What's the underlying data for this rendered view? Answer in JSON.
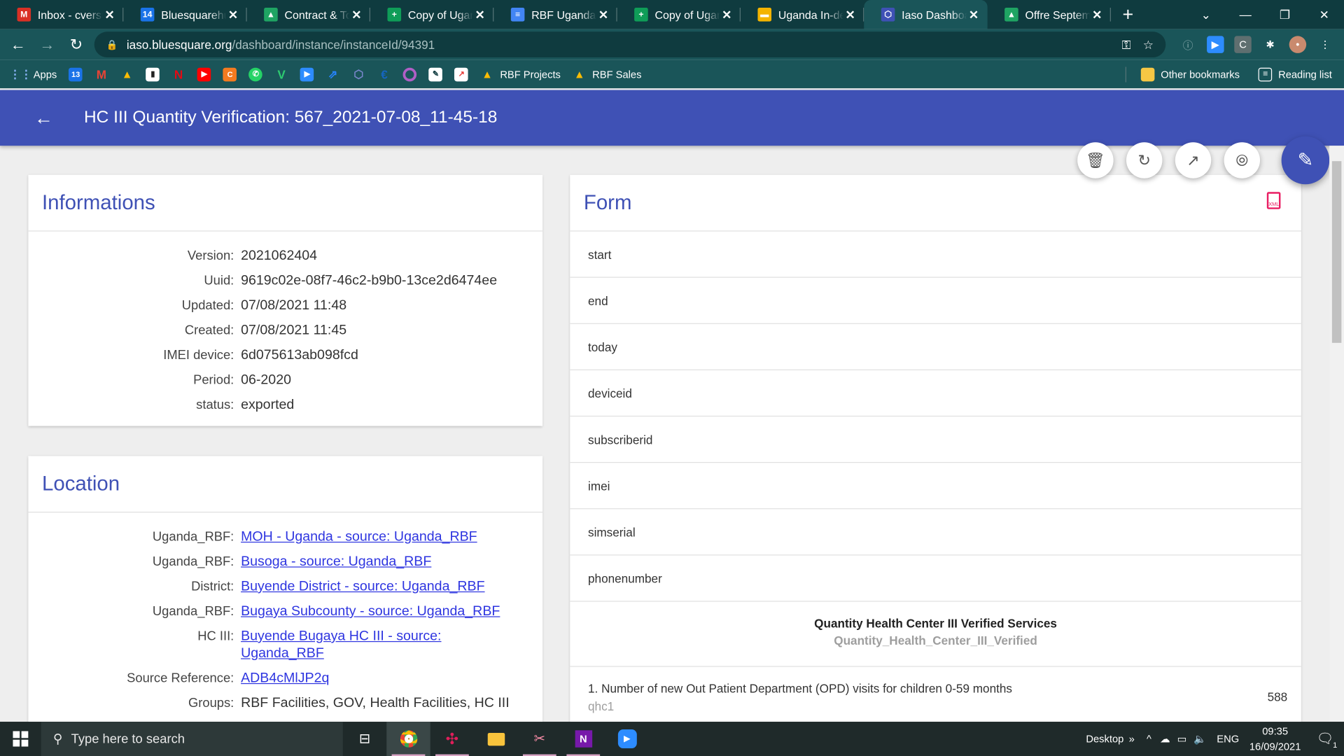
{
  "browser": {
    "tabs": [
      {
        "title": "Inbox - cverstr",
        "fav": "M",
        "color": "#d93025"
      },
      {
        "title": "Bluesquarehub",
        "fav": "14",
        "color": "#1a73e8"
      },
      {
        "title": "Contract & Tol",
        "fav": "▲",
        "color": "#1fa463"
      },
      {
        "title": "Copy of Uganda",
        "fav": "+",
        "color": "#0f9d58"
      },
      {
        "title": "RBF Uganda -",
        "fav": "≡",
        "color": "#4285f4"
      },
      {
        "title": "Copy of Uganda",
        "fav": "+",
        "color": "#0f9d58"
      },
      {
        "title": "Uganda In-dep",
        "fav": "▬",
        "color": "#f4b400"
      },
      {
        "title": "Iaso Dashboard",
        "fav": "⬡",
        "color": "#3f51b5"
      },
      {
        "title": "Offre Septemb",
        "fav": "▲",
        "color": "#1fa463"
      }
    ],
    "url_host": "iaso.bluesquare.org",
    "url_path": "/dashboard/instance/instanceId/94391",
    "bookmarks": {
      "apps": "Apps",
      "rbf_projects": "RBF Projects",
      "rbf_sales": "RBF Sales",
      "other": "Other bookmarks",
      "reading": "Reading list"
    }
  },
  "header": {
    "title": "HC III Quantity Verification: 567_2021-07-08_11-45-18"
  },
  "informations": {
    "title": "Informations",
    "rows": [
      {
        "label": "Version:",
        "value": "2021062404"
      },
      {
        "label": "Uuid:",
        "value": "9619c02e-08f7-46c2-b9b0-13ce2d6474ee"
      },
      {
        "label": "Updated:",
        "value": "07/08/2021 11:48"
      },
      {
        "label": "Created:",
        "value": "07/08/2021 11:45"
      },
      {
        "label": "IMEI device:",
        "value": "6d075613ab098fcd"
      },
      {
        "label": "Period:",
        "value": "06-2020"
      },
      {
        "label": "status:",
        "value": "exported"
      }
    ]
  },
  "location": {
    "title": "Location",
    "rows": [
      {
        "label": "Uganda_RBF:",
        "value": "MOH - Uganda - source: Uganda_RBF"
      },
      {
        "label": "Uganda_RBF:",
        "value": "Busoga - source: Uganda_RBF"
      },
      {
        "label": "District:",
        "value": "Buyende District - source: Uganda_RBF"
      },
      {
        "label": "Uganda_RBF:",
        "value": "Bugaya Subcounty - source: Uganda_RBF"
      },
      {
        "label": "HC III:",
        "value": "Buyende Bugaya HC III - source: Uganda_RBF"
      },
      {
        "label": "Source Reference:",
        "value": "ADB4cMlJP2q"
      },
      {
        "label": "Groups:",
        "value": "RBF Facilities, GOV, Health Facilities, HC III"
      }
    ]
  },
  "form": {
    "title": "Form",
    "fields": [
      "start",
      "end",
      "today",
      "deviceid",
      "subscriberid",
      "imei",
      "simserial",
      "phonenumber"
    ],
    "section_label": "Quantity Health Center III Verified Services",
    "section_code": "Quantity_Health_Center_III_Verified",
    "question": "1. Number of new Out Patient Department (OPD) visits for children 0-59 months",
    "question_code": "qhc1",
    "question_value": "588"
  },
  "taskbar": {
    "search_placeholder": "Type here to search",
    "desktop": "Desktop",
    "lang": "ENG",
    "time": "09:35",
    "date": "16/09/2021",
    "notif_count": "1"
  }
}
